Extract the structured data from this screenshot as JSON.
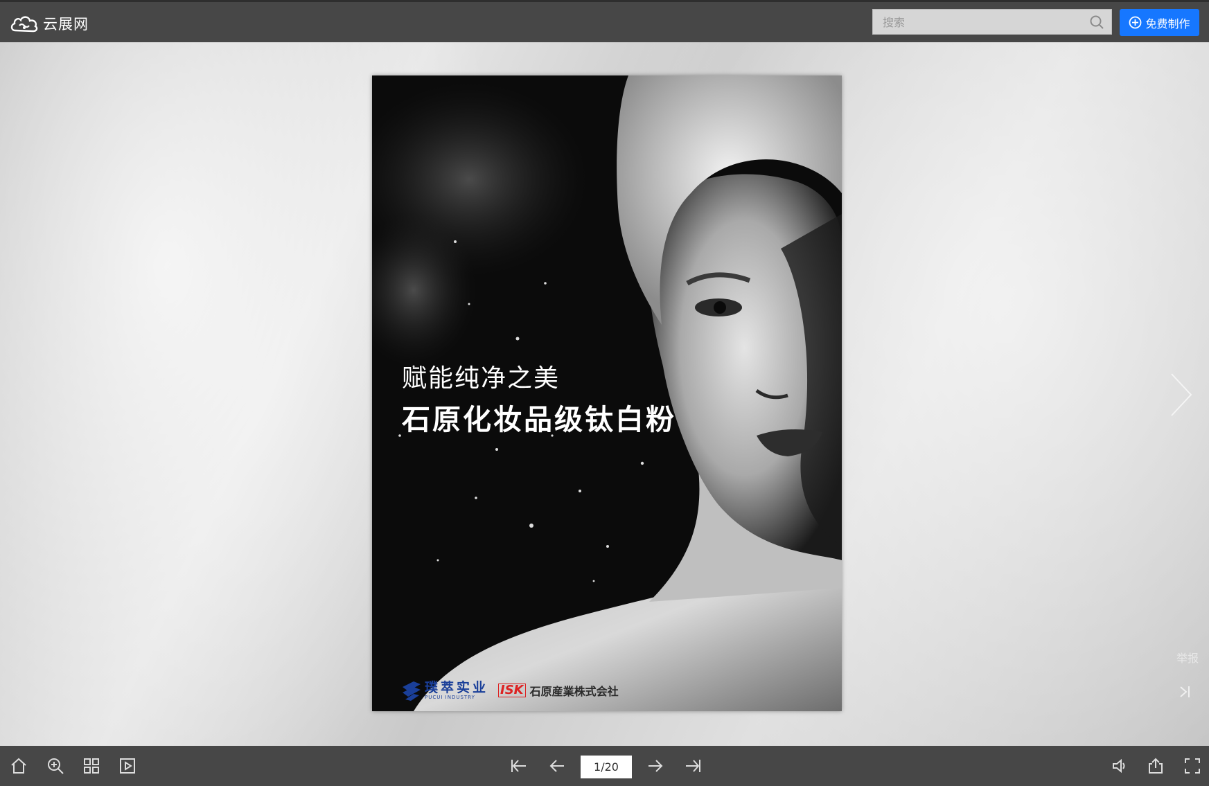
{
  "header": {
    "logo_text": "云展网",
    "search_placeholder": "搜索",
    "make_button_label": "免费制作"
  },
  "flipbook": {
    "cover": {
      "headline": "赋能纯净之美",
      "title": "石原化妆品级钛白粉",
      "brand_pucui_name": "璞萃实业",
      "brand_pucui_sub": "PUCUI INDUSTRY",
      "brand_isk_logo": "ISK",
      "brand_isk_name": "石原産業株式会社"
    },
    "report_label": "举报",
    "page_indicator": "1/20",
    "current_page": 1,
    "total_pages": 20
  },
  "toolbar": {
    "left_icons": [
      "home-icon",
      "zoom-in-icon",
      "thumbnails-icon",
      "autoplay-icon"
    ],
    "nav_icons": [
      "first-page-icon",
      "prev-page-icon",
      "next-page-icon",
      "last-page-icon"
    ],
    "right_icons": [
      "sound-icon",
      "share-icon",
      "fullscreen-icon"
    ]
  },
  "colors": {
    "topbar": "#474747",
    "accent": "#1677ff"
  }
}
